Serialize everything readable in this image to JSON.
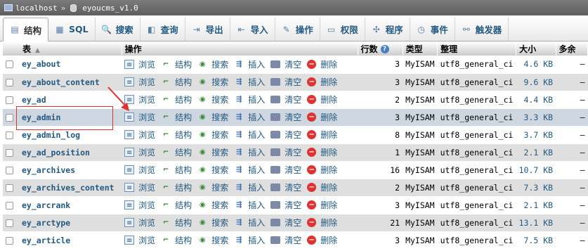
{
  "breadcrumb": {
    "server": "localhost",
    "separator": "»",
    "database": "eyoucms_v1.0"
  },
  "tabs": [
    {
      "label": "结构",
      "icon": "structure-icon",
      "active": true
    },
    {
      "label": "SQL",
      "icon": "sql-icon"
    },
    {
      "label": "搜索",
      "icon": "search-icon"
    },
    {
      "label": "查询",
      "icon": "query-icon"
    },
    {
      "label": "导出",
      "icon": "export-icon"
    },
    {
      "label": "导入",
      "icon": "import-icon"
    },
    {
      "label": "操作",
      "icon": "wrench-icon"
    },
    {
      "label": "权限",
      "icon": "privileges-icon"
    },
    {
      "label": "程序",
      "icon": "routines-icon"
    },
    {
      "label": "事件",
      "icon": "events-icon"
    },
    {
      "label": "触发器",
      "icon": "triggers-icon"
    }
  ],
  "columns": {
    "table": "表",
    "actions": "操作",
    "rows": "行数",
    "type": "类型",
    "collation": "整理",
    "size": "大小",
    "overhead": "多余"
  },
  "action_labels": {
    "browse": "浏览",
    "structure": "结构",
    "search": "搜索",
    "insert": "插入",
    "empty": "清空",
    "drop": "删除"
  },
  "tables": [
    {
      "name": "ey_about",
      "rows": "3",
      "type": "MyISAM",
      "collation": "utf8_general_ci",
      "size": "4.6 KB",
      "overhead": "–"
    },
    {
      "name": "ey_about_content",
      "rows": "3",
      "type": "MyISAM",
      "collation": "utf8_general_ci",
      "size": "9.6 KB",
      "overhead": "–"
    },
    {
      "name": "ey_ad",
      "rows": "2",
      "type": "MyISAM",
      "collation": "utf8_general_ci",
      "size": "4.4 KB",
      "overhead": "–"
    },
    {
      "name": "ey_admin",
      "rows": "3",
      "type": "MyISAM",
      "collation": "utf8_general_ci",
      "size": "3.3 KB",
      "overhead": "–"
    },
    {
      "name": "ey_admin_log",
      "rows": "8",
      "type": "MyISAM",
      "collation": "utf8_general_ci",
      "size": "3.7 KB",
      "overhead": "–"
    },
    {
      "name": "ey_ad_position",
      "rows": "1",
      "type": "MyISAM",
      "collation": "utf8_general_ci",
      "size": "2.1 KB",
      "overhead": "–"
    },
    {
      "name": "ey_archives",
      "rows": "16",
      "type": "MyISAM",
      "collation": "utf8_general_ci",
      "size": "10.7 KB",
      "overhead": "–"
    },
    {
      "name": "ey_archives_content",
      "rows": "2",
      "type": "MyISAM",
      "collation": "utf8_general_ci",
      "size": "7.3 KB",
      "overhead": "–"
    },
    {
      "name": "ey_arcrank",
      "rows": "3",
      "type": "MyISAM",
      "collation": "utf8_general_ci",
      "size": "2.1 KB",
      "overhead": "–"
    },
    {
      "name": "ey_arctype",
      "rows": "21",
      "type": "MyISAM",
      "collation": "utf8_general_ci",
      "size": "13.1 KB",
      "overhead": "–"
    },
    {
      "name": "ey_article",
      "rows": "3",
      "type": "MyISAM",
      "collation": "utf8_general_ci",
      "size": "7.5 KB",
      "overhead": "–"
    }
  ],
  "highlighted_row": "ey_admin",
  "colors": {
    "link": "#235a81",
    "row_alt": "#dfdfdf",
    "row_hover": "#ced6df",
    "annotation": "#e03030"
  }
}
